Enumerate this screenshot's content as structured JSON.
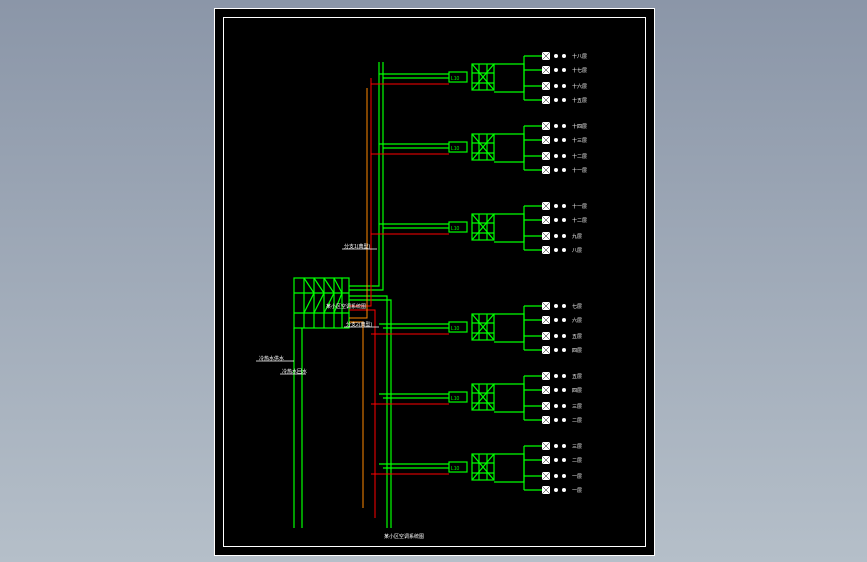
{
  "diagram": {
    "title": "某小区空调系统图",
    "main_supply_label": "冷热水供水",
    "main_return_label": "冷热水回水",
    "mid_label_1": "分支1(典型)",
    "mid_label_2": "某小区空调系统图",
    "mid_label_3": "分支2(典型)",
    "branch_box": "L10",
    "branches": [
      {
        "outlets": [
          "十八层",
          "十七层",
          "十六层",
          "十五层"
        ]
      },
      {
        "outlets": [
          "十四层",
          "十三层",
          "十二层",
          "十一层"
        ]
      },
      {
        "outlets": [
          "十一层",
          "十二层",
          "九层",
          "八层"
        ]
      },
      {
        "outlets": [
          "七层",
          "六层",
          "五层",
          "四层"
        ]
      },
      {
        "outlets": [
          "五层",
          "四层",
          "三层",
          "二层"
        ]
      },
      {
        "outlets": [
          "三层",
          "二层",
          "一层",
          "一层"
        ]
      }
    ]
  }
}
